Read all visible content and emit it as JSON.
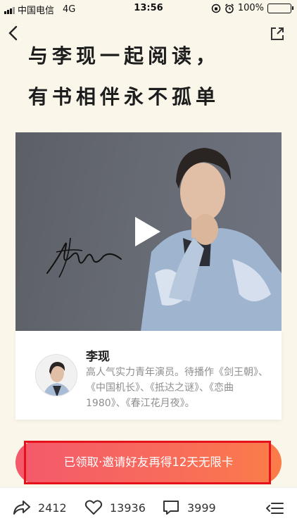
{
  "status_bar": {
    "carrier": "中国电信",
    "network": "4G",
    "time": "13:56",
    "battery": "100%",
    "battery_color": "#3cc23c"
  },
  "nav": {
    "back_icon": "chevron-left-icon",
    "share_icon": "share-external-icon"
  },
  "headline": {
    "line1": "与李现一起阅读，",
    "line2": "有书相伴永不孤单"
  },
  "video": {
    "play_icon": "play-icon",
    "signature_icon": "signature-icon"
  },
  "author": {
    "name": "李现",
    "bio": "高人气实力青年演员。待播作《剑王朝》、《中国机长》、《抵达之谜》、《恋曲1980》、《春江花月夜》。"
  },
  "cta": {
    "label": "已领取·邀请好友再得12天无限卡",
    "gradient_start": "#f4596b",
    "gradient_end": "#fb7d49",
    "highlight_color": "#e5111b"
  },
  "bottom_bar": {
    "share_count": "2412",
    "like_count": "13936",
    "comment_count": "3999",
    "menu_icon": "menu-icon"
  }
}
